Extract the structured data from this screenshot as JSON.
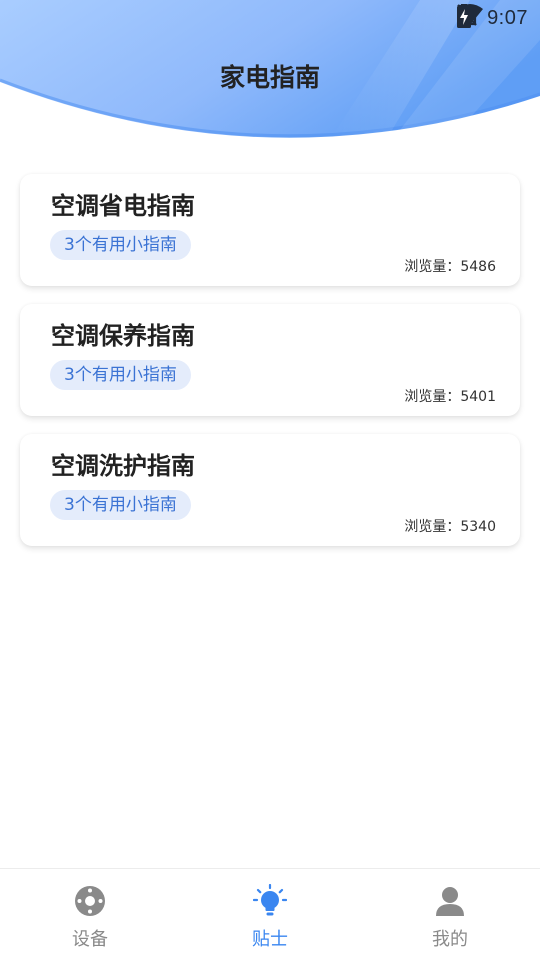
{
  "status_bar": {
    "time": "9:07",
    "icons": [
      "wifi-icon",
      "no-sim-icon",
      "battery-charging-icon"
    ]
  },
  "header": {
    "title": "家电指南",
    "gradient_colors": [
      "#9fc7ff",
      "#5f9ef5"
    ]
  },
  "guides": [
    {
      "title": "空调省电指南",
      "tag": "3个有用小指南",
      "views": "浏览量：5486"
    },
    {
      "title": "空调保养指南",
      "tag": "3个有用小指南",
      "views": "浏览量：5401"
    },
    {
      "title": "空调洗护指南",
      "tag": "3个有用小指南",
      "views": "浏览量：5340"
    }
  ],
  "tabbar": {
    "active_color": "#3a86f0",
    "inactive_color": "#8a8a8a",
    "tabs": [
      {
        "label": "设备",
        "icon": "device-icon",
        "active": false
      },
      {
        "label": "贴士",
        "icon": "lightbulb-icon",
        "active": true
      },
      {
        "label": "我的",
        "icon": "user-icon",
        "active": false
      }
    ]
  }
}
